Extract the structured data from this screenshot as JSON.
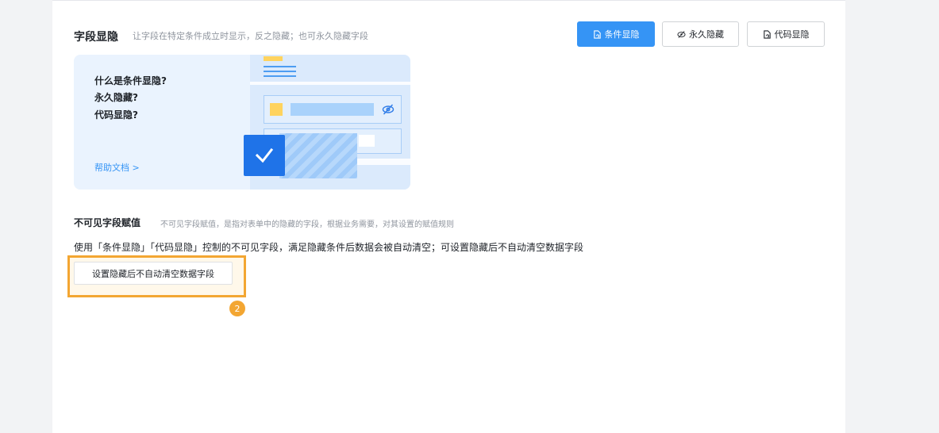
{
  "section": {
    "title": "字段显隐",
    "description": "让字段在特定条件成立时显示，反之隐藏；也可永久隐藏字段"
  },
  "buttons": {
    "conditional": "条件显隐",
    "permanent_hide": "永久隐藏",
    "code": "代码显隐"
  },
  "help_card": {
    "questions": [
      "什么是条件显隐?",
      "永久隐藏?",
      "代码显隐?"
    ],
    "link": "帮助文档 >"
  },
  "invisible": {
    "title": "不可见字段赋值",
    "description": "不可见字段赋值，是指对表单中的隐藏的字段，根据业务需要，对其设置的赋值规则",
    "text": "使用「条件显隐」「代码显隐」控制的不可见字段，满足隐藏条件后数据会被自动清空；可设置隐藏后不自动清空数据字段",
    "setting_button": "设置隐藏后不自动清空数据字段"
  },
  "step_badge": "2",
  "colors": {
    "accent": "#3594f5",
    "highlight": "#f3a632"
  }
}
